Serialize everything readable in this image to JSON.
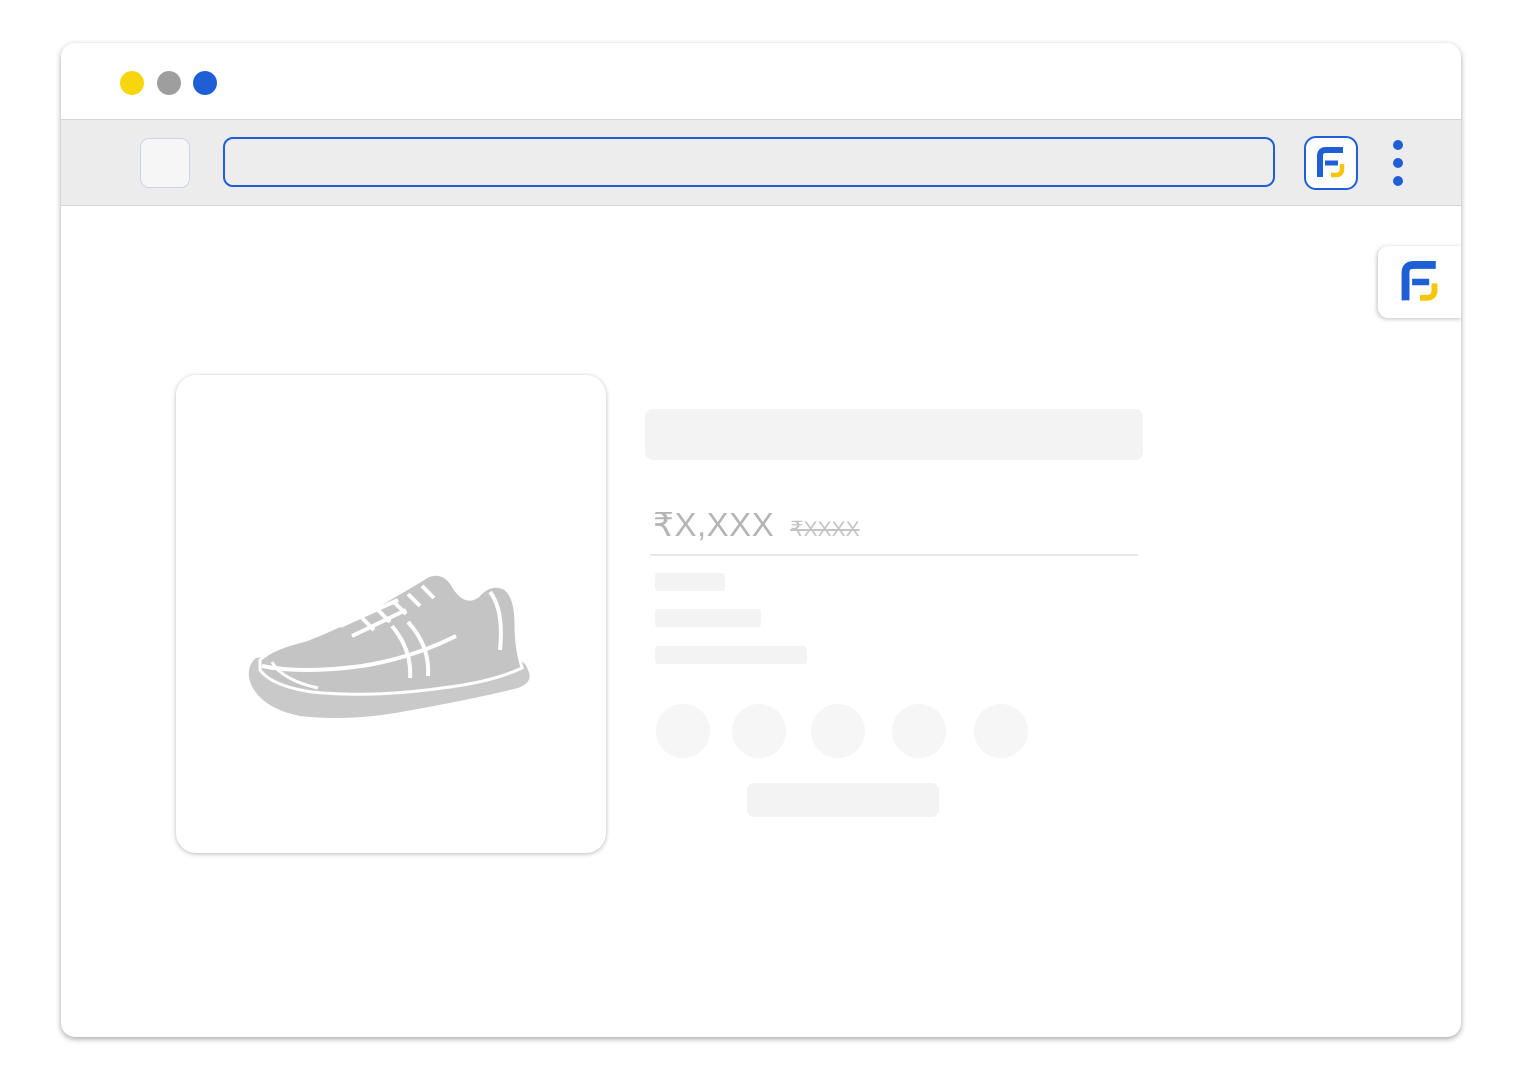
{
  "colors": {
    "traffic_yellow": "#f7d60e",
    "traffic_gray": "#9e9e9e",
    "traffic_blue": "#1f5fd6",
    "accent_blue": "#1f5fd6",
    "logo_yellow": "#f5c50a",
    "skeleton": "#f3f3f3"
  },
  "address_bar": {
    "value": "",
    "placeholder": ""
  },
  "icons": {
    "extension": "fj-logo-icon",
    "menu": "kebab-menu-icon",
    "product": "sneaker-icon"
  },
  "product": {
    "price": "₹X,XXX",
    "mrp": "₹XXXX"
  }
}
